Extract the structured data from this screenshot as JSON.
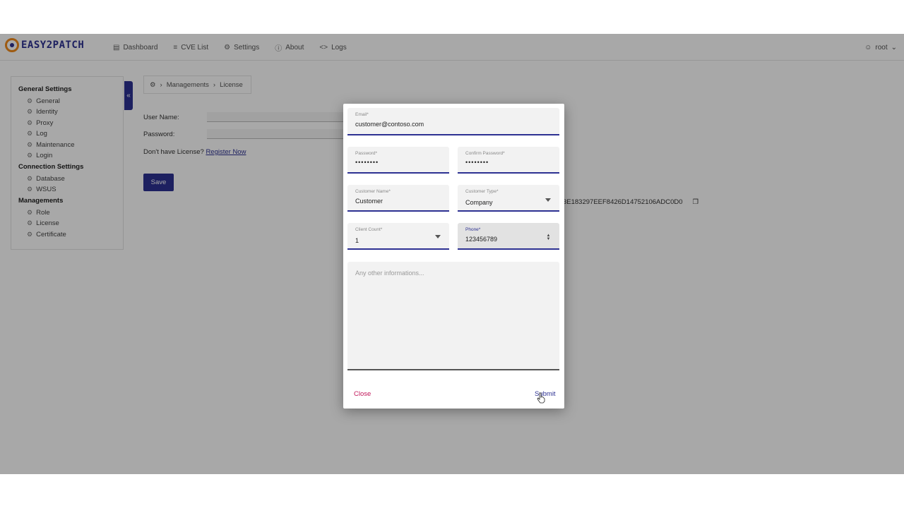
{
  "app": {
    "logo_text": "EASY2PATCH"
  },
  "nav": {
    "items": [
      {
        "label": "Dashboard",
        "icon": "chart-icon"
      },
      {
        "label": "CVE List",
        "icon": "list-icon"
      },
      {
        "label": "Settings",
        "icon": "gear-icon"
      },
      {
        "label": "About",
        "icon": "info-icon"
      },
      {
        "label": "Logs",
        "icon": "code-icon"
      }
    ],
    "user": "root"
  },
  "sidebar": {
    "sections": [
      {
        "title": "General Settings",
        "items": [
          "General",
          "Identity",
          "Proxy",
          "Log",
          "Maintenance",
          "Login"
        ]
      },
      {
        "title": "Connection Settings",
        "items": [
          "Database",
          "WSUS"
        ]
      },
      {
        "title": "Managements",
        "items": [
          "Role",
          "License",
          "Certificate"
        ]
      }
    ]
  },
  "breadcrumb": {
    "items": [
      "Managements",
      "License"
    ]
  },
  "license_form": {
    "username_label": "User Name:",
    "password_label": "Password:",
    "no_license_text": "Don't have License?",
    "register_link": "Register Now",
    "save_label": "Save",
    "machine_id_partial": "3E183297EEF8426D14752106ADC0D0"
  },
  "modal": {
    "email": {
      "label": "Email*",
      "value": "customer@contoso.com"
    },
    "password": {
      "label": "Password*",
      "value": "••••••••"
    },
    "confirm_password": {
      "label": "Confirm Password*",
      "value": "••••••••"
    },
    "customer_name": {
      "label": "Customer Name*",
      "value": "Customer"
    },
    "customer_type": {
      "label": "Customer Type*",
      "value": "Company"
    },
    "client_count": {
      "label": "Client Count*",
      "value": "1"
    },
    "phone": {
      "label": "Phone*",
      "value": "123456789"
    },
    "notes": {
      "placeholder": "Any other informations..."
    },
    "close_label": "Close",
    "submit_label": "Submit"
  },
  "colors": {
    "brand": "#2d3192",
    "logo_accent": "#f08a1c",
    "close": "#c2185b"
  }
}
